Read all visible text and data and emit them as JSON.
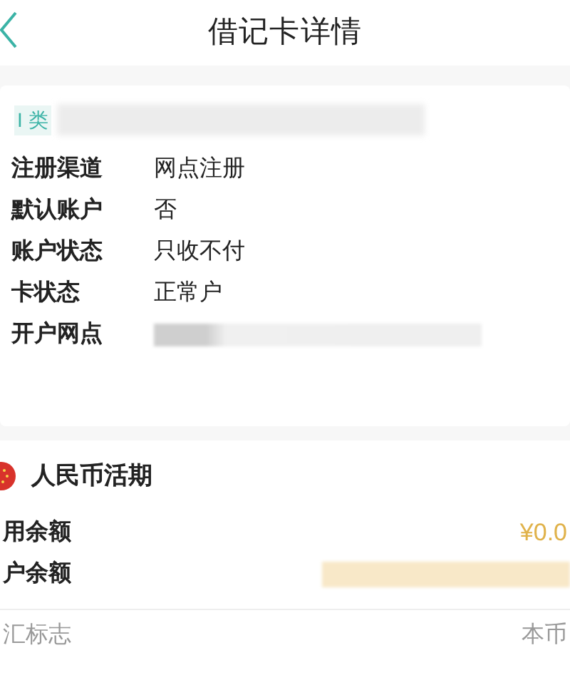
{
  "header": {
    "title": "借记卡详情"
  },
  "card": {
    "type_label": "I 类",
    "rows": [
      {
        "label": "注册渠道",
        "value": "网点注册"
      },
      {
        "label": "默认账户",
        "value": "否"
      },
      {
        "label": "账户状态",
        "value": "只收不付"
      },
      {
        "label": "卡状态",
        "value": "正常户"
      },
      {
        "label": "开户网点"
      }
    ]
  },
  "account": {
    "title": "人民币活期",
    "rows": [
      {
        "label": "用余额",
        "value": "¥0.0"
      },
      {
        "label": "户余额"
      }
    ],
    "footer": {
      "label": "汇标志",
      "value": "本币"
    }
  }
}
